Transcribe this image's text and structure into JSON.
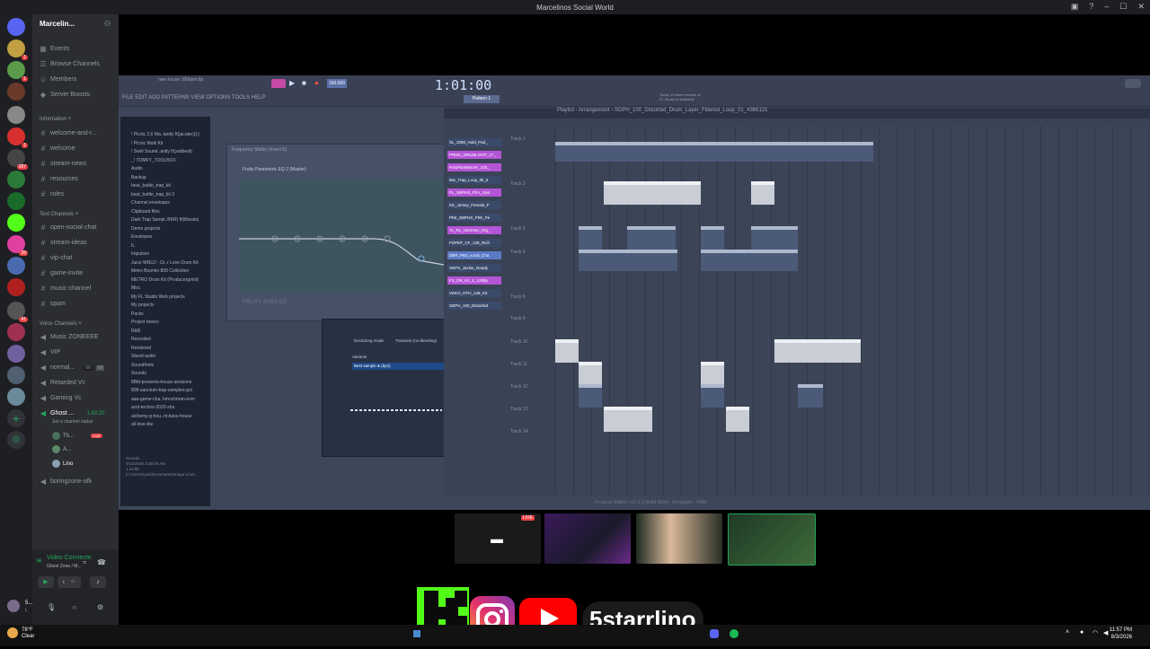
{
  "window": {
    "title": "Marcelinos Social World"
  },
  "server": {
    "name": "Marcelin..."
  },
  "nav": [
    {
      "label": "Events",
      "icon": "calendar-icon"
    },
    {
      "label": "Browse Channels",
      "icon": "browse-icon"
    },
    {
      "label": "Members",
      "icon": "members-icon"
    },
    {
      "label": "Server Boosts",
      "icon": "boost-icon"
    }
  ],
  "categories": {
    "information": "Information",
    "text": "Text Channels",
    "voice": "Voice Channels"
  },
  "info_channels": [
    "welcome-and-r...",
    "welcome",
    "stream-news",
    "resources",
    "roles"
  ],
  "text_channels": [
    "open-social-chat",
    "stream-ideas",
    "vip-chat",
    "game-invite",
    "music-channel",
    "spam"
  ],
  "voice_channels": [
    {
      "name": "Music ZONEEEE"
    },
    {
      "name": "VIP"
    },
    {
      "name": "normal...",
      "count_a": "00",
      "count_b": "08"
    },
    {
      "name": "Retarded Vc"
    },
    {
      "name": "Gaming Vc"
    }
  ],
  "active_voice": {
    "name": "Ghost ...",
    "timer": "1:43:20",
    "status": "Set a channel status"
  },
  "voice_users": [
    {
      "name": "Th...",
      "live": "LIVE"
    },
    {
      "name": "A..."
    },
    {
      "name": "Lino"
    }
  ],
  "afk_channel": "boringzone-afk",
  "voice_connection": {
    "label": "Video Connecte",
    "sub": "Ghost Zone / M..."
  },
  "user": {
    "name": "5...",
    "tag": "L"
  },
  "server_badges": [
    "1",
    "1",
    "1",
    "287",
    "1",
    "1",
    "1",
    "28",
    "1",
    "41",
    "1",
    "1",
    "3"
  ],
  "fl": {
    "project": "new house 160bpm.flp",
    "menu": "FILE EDIT ADD PATTERNS VIEW OPTIONS TOOLS HELP",
    "timecode": "1:01:00",
    "pattern": "Pattern 1",
    "playlist_title": "Playlist - Arrangement › SDPH_100_Distorted_Drum_Layer_Filtered_Loop_01_4366121",
    "hint": "Today: A newer version of FL Studio is available!",
    "tempo": "160.000",
    "eq_title": "Frequency Shifter (Insert 6)",
    "eq_label": "Fruity Parametric EQ 2 (Master)",
    "eq_footer": "FRUITY PARA EQ",
    "sampler_mode": "Declicking mode",
    "sampler_transient": "Transient (no bleeding)",
    "sampler_variants": "Variants",
    "sampler_best": "Best sample & (bpc)",
    "status": "Producer Edition v21.2.3 [build 4004] - All plugins - 64Bit",
    "browser_items": [
      "! Picnic 2.0 Ma..tantly ft(jacobe)(1)",
      "! Picnic Multi Kit",
      "! Swirl Sound..antly ft(yadbeat)",
      "_! TOMFY_TOOLBOX",
      "Audio",
      "Backup",
      "beat_battle_trap_kit",
      "beat_battle_trap_kit 3",
      "Channel envelopes",
      "Clipboard files",
      "Dark Trap Sampl..BKR) ft(lilbeats)",
      "Demo projects",
      "Envelopes",
      "IL",
      "Impulses",
      "Juice WRLD - Dr..r Love Drum Kit",
      "Metro Boomin 808 Collection",
      "METRO Drum Kit (Producergrind)",
      "Misc",
      "My FL Studio Web projects",
      "My projects",
      "Packs",
      "Project bones",
      "R&B",
      "Recorded",
      "Rendered",
      "Sliced audio",
      "Soundfonts",
      "Sounds",
      "8Bitt-presents-house-sessions",
      "808-sanctum-trap-samples-gol",
      "aaa-game-cha..hmochman-evm",
      "acid-techno-2020-sha",
      "alchemy-g-hou..nt-bass-house",
      "all-love-the"
    ],
    "browser_info": [
      "Sounds",
      "3/14/2026 3:39:08 AM",
      "1.44 kb",
      "C:\\Users\\ryan\\Documents\\Image-Line\\..."
    ],
    "channels": [
      {
        "name": "SL_2080_Hold_Pad_",
        "color": "#3a4a6a"
      },
      {
        "name": "PRMC_DRUMLOOP_17_",
        "color": "#b455d6"
      },
      {
        "name": "PoloPlotMelvAE_220_",
        "color": "#b455d6"
      },
      {
        "name": "Bar_Trap_Loop_0k_9",
        "color": "#3a4a6a"
      },
      {
        "name": "PL_SBPHS_PhA_Syst",
        "color": "#b455d6"
      },
      {
        "name": "KK_Jersey_Female_F",
        "color": "#3a4a6a"
      },
      {
        "name": "PhE_SBPHS_PhE_Pe",
        "color": "#3a4a6a"
      },
      {
        "name": "7L_RL_Hummer_Org_",
        "color": "#b455d6"
      },
      {
        "name": "FDPKP_CF_128_Rich",
        "color": "#3a4a6a"
      },
      {
        "name": "DBR_PB3_vocal_Cha",
        "color": "#5a7ac6"
      },
      {
        "name": "SDPS_Jackie_Deady",
        "color": "#3a4a6a"
      },
      {
        "name": "FX_DR_Kit_S_128bp",
        "color": "#b455d6"
      },
      {
        "name": "VEKO_OTH_128_Kit",
        "color": "#3a4a6a"
      },
      {
        "name": "SDPH_100_Distorted",
        "color": "#3a4a6a"
      }
    ],
    "tracks": [
      "Track 1",
      "Track 3",
      "Track 5",
      "Track 6",
      "Track 8",
      "Track 9",
      "Track 10",
      "Track 11",
      "Track 12",
      "Track 13",
      "Track 14"
    ]
  },
  "stream_live_badge": "LIVE",
  "overlay": {
    "handle": "5starrlino"
  },
  "taskbar": {
    "temp": "78°F",
    "weather": "Clear",
    "time": "11:57 PM",
    "date": "8/3/2026"
  }
}
